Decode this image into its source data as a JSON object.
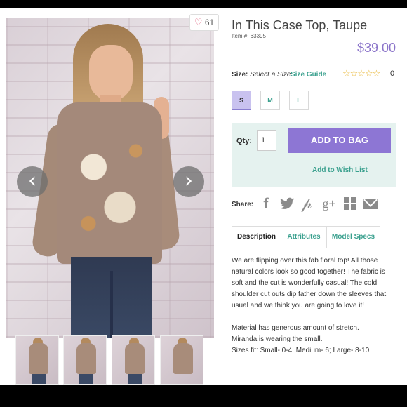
{
  "product": {
    "title": "In This Case Top, Taupe",
    "item_number": "Item #: 63395",
    "price": "$39.00",
    "likes": "61",
    "accent_color": "#8d76d4",
    "link_color": "#3aa08e"
  },
  "sizes": {
    "label": "Size:",
    "selected_text": "Select a Size",
    "guide_label": "Size Guide",
    "options": [
      "S",
      "M",
      "L"
    ],
    "active": "S"
  },
  "rating": {
    "stars": "☆☆☆☆☆",
    "max_stars": 5,
    "count": "0"
  },
  "cart": {
    "qty_label": "Qty:",
    "qty_value": "1",
    "add_button": "ADD TO BAG",
    "wishlist": "Add to Wish List"
  },
  "share": {
    "label": "Share:",
    "icons": [
      "facebook-icon",
      "twitter-icon",
      "pinterest-icon",
      "google-plus-icon",
      "grid-icon",
      "mail-icon"
    ],
    "google_plus_text": "g+"
  },
  "tabs": [
    "Description",
    "Attributes",
    "Model Specs"
  ],
  "description": {
    "paragraph1": "We are flipping over this fab floral top! All those natural colors look so good together! The fabric is soft and the cut is wonderfully casual! The cold shoulder cut outs dip father down the sleeves that usual and we think you are going to love it!",
    "line1": "Material has generous amount of stretch.",
    "line2": "Miranda is wearing the small.",
    "line3": "Sizes fit: Small- 0-4; Medium- 6; Large- 8-10"
  },
  "gallery": {
    "arrow_left": "‹",
    "arrow_right": "›",
    "thumbnail_count": 4
  }
}
